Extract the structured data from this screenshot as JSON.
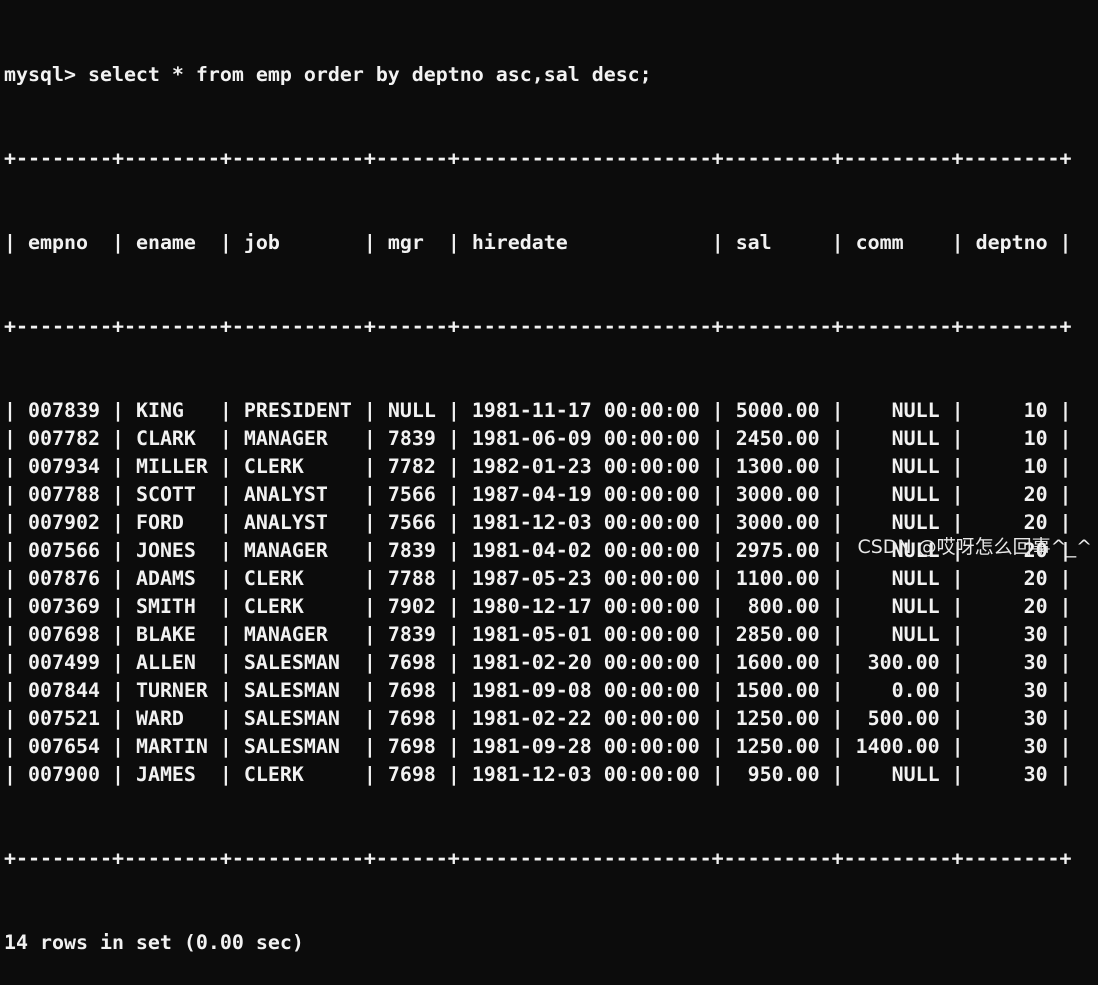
{
  "terminal": {
    "prompt": "mysql> select * from emp order by deptno asc,sal desc;",
    "border": "+--------+--------+-----------+------+---------------------+---------+---------+--------+",
    "columns": [
      "empno",
      "ename",
      "job",
      "mgr",
      "hiredate",
      "sal",
      "comm",
      "deptno"
    ],
    "rows": [
      [
        "007839",
        "KING",
        "PRESIDENT",
        "NULL",
        "1981-11-17 00:00:00",
        "5000.00",
        "NULL",
        "10"
      ],
      [
        "007782",
        "CLARK",
        "MANAGER",
        "7839",
        "1981-06-09 00:00:00",
        "2450.00",
        "NULL",
        "10"
      ],
      [
        "007934",
        "MILLER",
        "CLERK",
        "7782",
        "1982-01-23 00:00:00",
        "1300.00",
        "NULL",
        "10"
      ],
      [
        "007788",
        "SCOTT",
        "ANALYST",
        "7566",
        "1987-04-19 00:00:00",
        "3000.00",
        "NULL",
        "20"
      ],
      [
        "007902",
        "FORD",
        "ANALYST",
        "7566",
        "1981-12-03 00:00:00",
        "3000.00",
        "NULL",
        "20"
      ],
      [
        "007566",
        "JONES",
        "MANAGER",
        "7839",
        "1981-04-02 00:00:00",
        "2975.00",
        "NULL",
        "20"
      ],
      [
        "007876",
        "ADAMS",
        "CLERK",
        "7788",
        "1987-05-23 00:00:00",
        "1100.00",
        "NULL",
        "20"
      ],
      [
        "007369",
        "SMITH",
        "CLERK",
        "7902",
        "1980-12-17 00:00:00",
        "800.00",
        "NULL",
        "20"
      ],
      [
        "007698",
        "BLAKE",
        "MANAGER",
        "7839",
        "1981-05-01 00:00:00",
        "2850.00",
        "NULL",
        "30"
      ],
      [
        "007499",
        "ALLEN",
        "SALESMAN",
        "7698",
        "1981-02-20 00:00:00",
        "1600.00",
        "300.00",
        "30"
      ],
      [
        "007844",
        "TURNER",
        "SALESMAN",
        "7698",
        "1981-09-08 00:00:00",
        "1500.00",
        "0.00",
        "30"
      ],
      [
        "007521",
        "WARD",
        "SALESMAN",
        "7698",
        "1981-02-22 00:00:00",
        "1250.00",
        "500.00",
        "30"
      ],
      [
        "007654",
        "MARTIN",
        "SALESMAN",
        "7698",
        "1981-09-28 00:00:00",
        "1250.00",
        "1400.00",
        "30"
      ],
      [
        "007900",
        "JAMES",
        "CLERK",
        "7698",
        "1981-12-03 00:00:00",
        "950.00",
        "NULL",
        "30"
      ]
    ],
    "footer": "14 rows in set (0.00 sec)"
  },
  "watermark": "CSDN @哎呀怎么回事^_^",
  "colors": {
    "background": "#0c0c0c",
    "text": "#f2f2f2"
  }
}
